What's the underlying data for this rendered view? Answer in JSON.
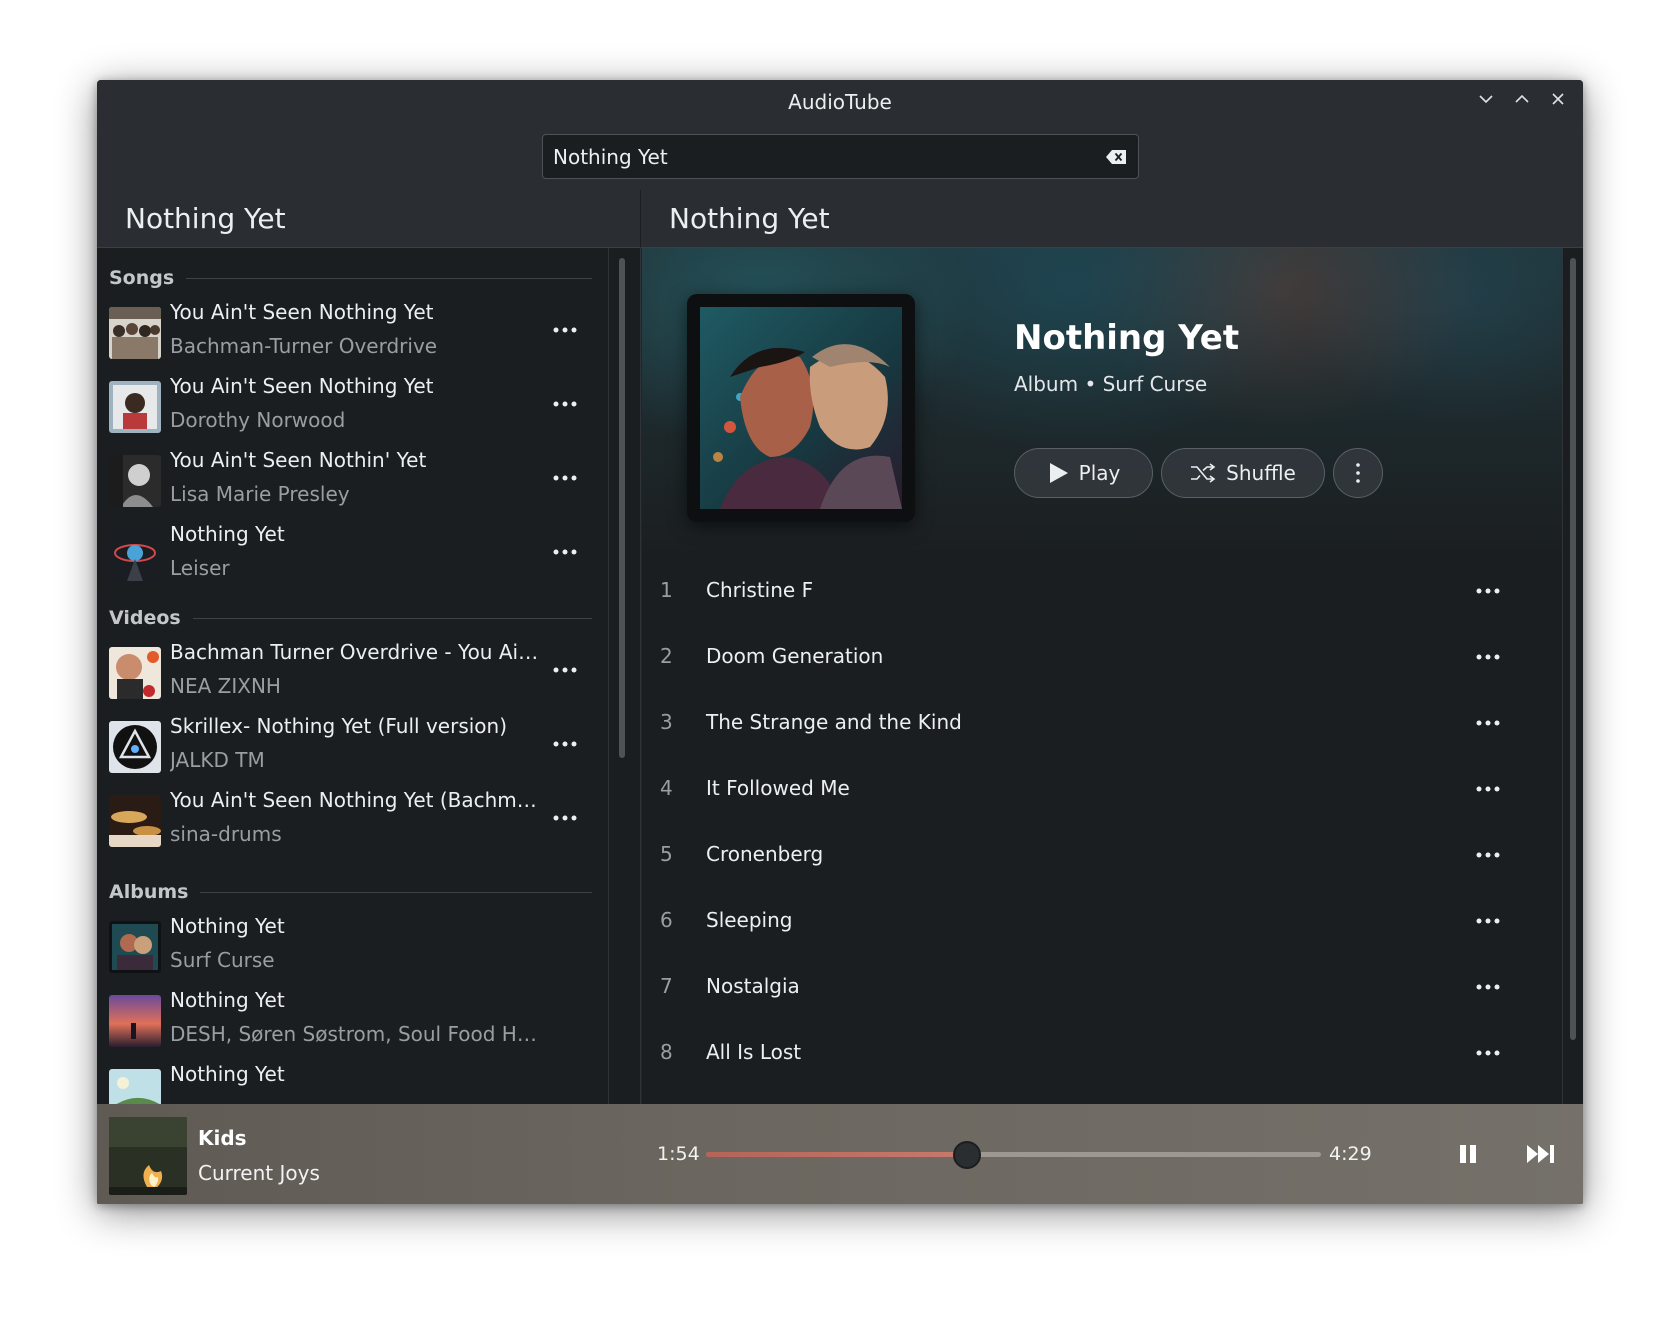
{
  "window": {
    "title": "AudioTube"
  },
  "search": {
    "value": "Nothing Yet"
  },
  "left_header": {
    "title": "Nothing Yet"
  },
  "right_header": {
    "title": "Nothing Yet"
  },
  "sections": {
    "songs": {
      "label": "Songs",
      "items": [
        {
          "title": "You Ain't Seen Nothing Yet",
          "subtitle": "Bachman-Turner Overdrive"
        },
        {
          "title": "You Ain't Seen Nothing Yet",
          "subtitle": "Dorothy Norwood"
        },
        {
          "title": "You Ain't Seen Nothin' Yet",
          "subtitle": "Lisa Marie Presley"
        },
        {
          "title": "Nothing Yet",
          "subtitle": "Leiser"
        }
      ]
    },
    "videos": {
      "label": "Videos",
      "items": [
        {
          "title": "Bachman Turner Overdrive - You Ain't ...",
          "subtitle": "NEA ZIXNH"
        },
        {
          "title": "Skrillex- Nothing Yet (Full version)",
          "subtitle": "JALKD TM"
        },
        {
          "title": "You Ain't Seen Nothing Yet (Bachman-...",
          "subtitle": "sina-drums"
        }
      ]
    },
    "albums": {
      "label": "Albums",
      "items": [
        {
          "title": "Nothing Yet",
          "subtitle": "Surf Curse"
        },
        {
          "title": "Nothing Yet",
          "subtitle": "DESH, Søren Søstrom, Soul Food Horns"
        },
        {
          "title": "Nothing Yet",
          "subtitle": ""
        }
      ]
    }
  },
  "album": {
    "title": "Nothing Yet",
    "subtitle": "Album • Surf Curse",
    "play_label": "Play",
    "shuffle_label": "Shuffle",
    "tracks": [
      {
        "number": "1",
        "title": "Christine F"
      },
      {
        "number": "2",
        "title": "Doom Generation"
      },
      {
        "number": "3",
        "title": "The Strange and the Kind"
      },
      {
        "number": "4",
        "title": "It Followed Me"
      },
      {
        "number": "5",
        "title": "Cronenberg"
      },
      {
        "number": "6",
        "title": "Sleeping"
      },
      {
        "number": "7",
        "title": "Nostalgia"
      },
      {
        "number": "8",
        "title": "All Is Lost"
      }
    ]
  },
  "player": {
    "title": "Kids",
    "artist": "Current Joys",
    "current_time": "1:54",
    "total_time": "4:29",
    "progress_fraction": 0.424
  },
  "icons": {
    "minimize": "chevron-down-icon",
    "maximize": "chevron-up-icon",
    "close": "close-icon",
    "clear": "backspace-clear-icon",
    "more": "more-horizontal-icon",
    "kebab": "more-vertical-icon",
    "play": "play-icon",
    "shuffle": "shuffle-icon",
    "pause": "pause-icon",
    "next": "skip-next-icon"
  },
  "colors": {
    "window_bg": "#232629",
    "list_bg": "#1b1e20",
    "accent_progress": "#b56457"
  }
}
